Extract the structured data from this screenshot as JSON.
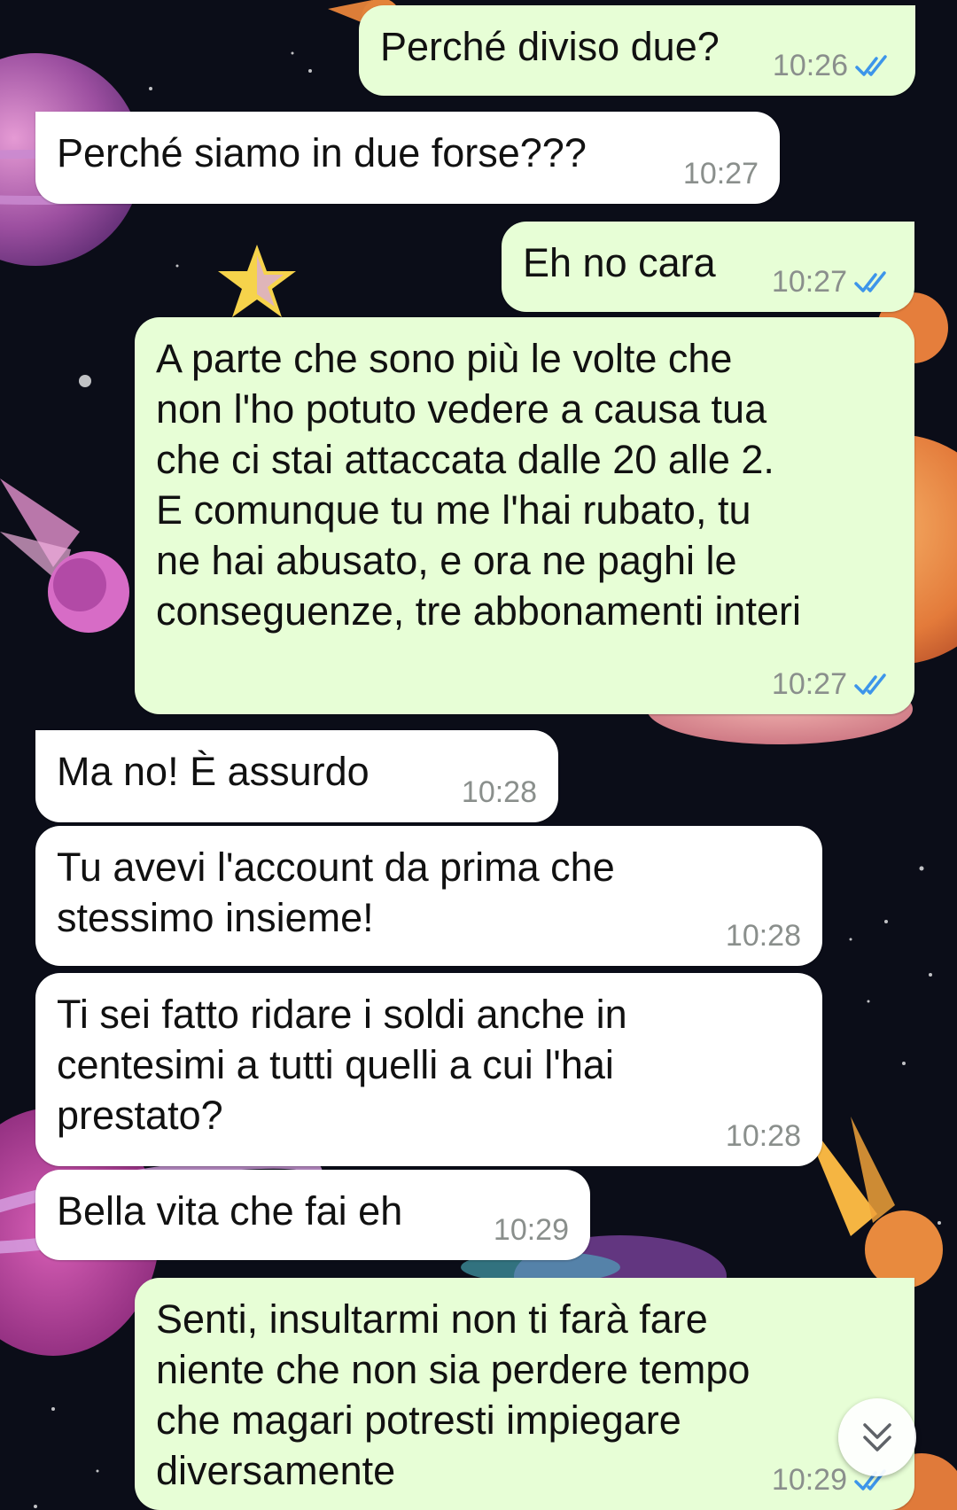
{
  "messages": [
    {
      "direction": "out",
      "text": "Perché diviso due?",
      "time": "10:26",
      "status": "read"
    },
    {
      "direction": "in",
      "text": "Perché siamo in due forse???",
      "time": "10:27"
    },
    {
      "direction": "out",
      "text": "Eh no cara",
      "time": "10:27",
      "status": "read"
    },
    {
      "direction": "out",
      "text": "A parte che sono più le volte che\nnon l'ho potuto vedere a causa tua\nche ci stai attaccata dalle 20 alle 2.\nE comunque tu me l'hai rubato, tu\nne hai abusato, e ora ne paghi le\nconseguenze, tre abbonamenti interi",
      "time": "10:27",
      "status": "read"
    },
    {
      "direction": "in",
      "text": "Ma no! È assurdo",
      "time": "10:28"
    },
    {
      "direction": "in",
      "text": "Tu avevi l'account da prima che\nstessimo insieme!",
      "time": "10:28"
    },
    {
      "direction": "in",
      "text": "Ti sei fatto ridare i soldi anche in\ncentesimi a tutti quelli a cui l'hai\nprestato?",
      "time": "10:28"
    },
    {
      "direction": "in",
      "text": "Bella vita che fai eh",
      "time": "10:29"
    },
    {
      "direction": "out",
      "text": "Senti, insultarmi non ti farà fare\nniente che non sia perdere tempo\nche magari potresti impiegare\ndiversamente",
      "time": "10:29",
      "status": "read"
    }
  ],
  "colors": {
    "outgoing_bubble": "#e7fed6",
    "incoming_bubble": "#ffffff",
    "read_ticks": "#3d95ea",
    "timestamp": "#8a8f8c",
    "wallpaper": "#0b0d18"
  },
  "icons": {
    "read_receipt": "double-check-icon",
    "scroll_down": "chevron-double-down-icon"
  }
}
